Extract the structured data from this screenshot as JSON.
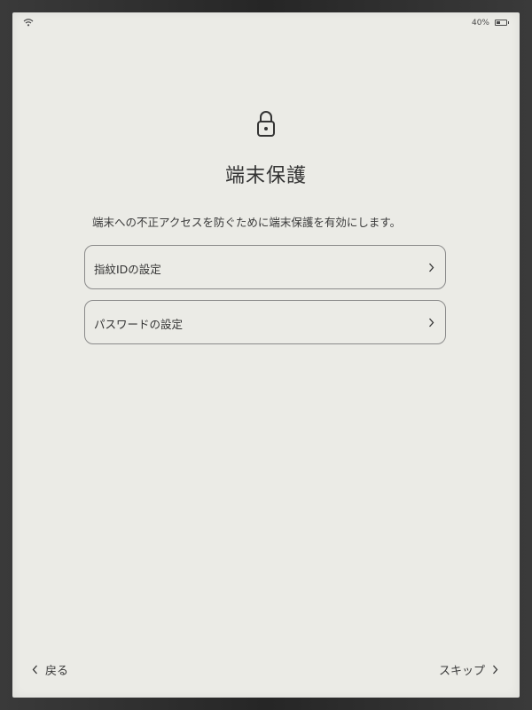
{
  "status_bar": {
    "wifi_icon": "wifi-icon",
    "battery_percent": "40%",
    "battery_level": 0.4,
    "battery_icon": "battery-icon"
  },
  "header": {
    "icon": "lock-icon",
    "title": "端末保護"
  },
  "main": {
    "description": "端末への不正アクセスを防ぐために端末保護を有効にします。",
    "options": [
      {
        "label": "指紋IDの設定",
        "icon": "chevron-right-icon"
      },
      {
        "label": "パスワードの設定",
        "icon": "chevron-right-icon"
      }
    ]
  },
  "footer": {
    "back_label": "戻る",
    "back_icon": "chevron-left-icon",
    "skip_label": "スキップ",
    "skip_icon": "chevron-right-icon"
  },
  "colors": {
    "screen_background": "#ebebe6",
    "text": "#333333",
    "border": "#8a8a8a",
    "bezel": "#2b2b2b"
  }
}
